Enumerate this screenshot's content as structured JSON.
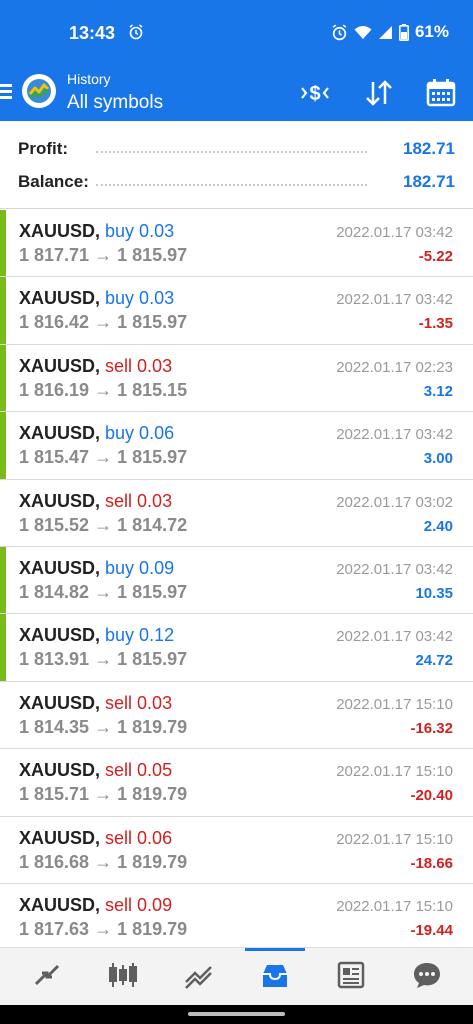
{
  "status_bar": {
    "time": "13:43",
    "battery": "61%"
  },
  "app_bar": {
    "title_small": "History",
    "title_big": "All symbols"
  },
  "summary": {
    "profit_label": "Profit:",
    "profit_value": "182.71",
    "balance_label": "Balance:",
    "balance_value": "182.71"
  },
  "deals": [
    {
      "symbol": "XAUUSD,",
      "side": "buy 0.03",
      "prices": "1 817.71 → 1 815.97",
      "date": "2022.01.17 03:42",
      "profit": "-5.22"
    },
    {
      "symbol": "XAUUSD,",
      "side": "buy 0.03",
      "prices": "1 816.42 → 1 815.97",
      "date": "2022.01.17 03:42",
      "profit": "-1.35"
    },
    {
      "symbol": "XAUUSD,",
      "side": "sell 0.03",
      "prices": "1 816.19 → 1 815.15",
      "date": "2022.01.17 02:23",
      "profit": "3.12"
    },
    {
      "symbol": "XAUUSD,",
      "side": "buy 0.06",
      "prices": "1 815.47 → 1 815.97",
      "date": "2022.01.17 03:42",
      "profit": "3.00"
    },
    {
      "symbol": "XAUUSD,",
      "side": "sell 0.03",
      "prices": "1 815.52 → 1 814.72",
      "date": "2022.01.17 03:02",
      "profit": "2.40"
    },
    {
      "symbol": "XAUUSD,",
      "side": "buy 0.09",
      "prices": "1 814.82 → 1 815.97",
      "date": "2022.01.17 03:42",
      "profit": "10.35"
    },
    {
      "symbol": "XAUUSD,",
      "side": "buy 0.12",
      "prices": "1 813.91 → 1 815.97",
      "date": "2022.01.17 03:42",
      "profit": "24.72"
    },
    {
      "symbol": "XAUUSD,",
      "side": "sell 0.03",
      "prices": "1 814.35 → 1 819.79",
      "date": "2022.01.17 15:10",
      "profit": "-16.32"
    },
    {
      "symbol": "XAUUSD,",
      "side": "sell 0.05",
      "prices": "1 815.71 → 1 819.79",
      "date": "2022.01.17 15:10",
      "profit": "-20.40"
    },
    {
      "symbol": "XAUUSD,",
      "side": "sell 0.06",
      "prices": "1 816.68 → 1 819.79",
      "date": "2022.01.17 15:10",
      "profit": "-18.66"
    },
    {
      "symbol": "XAUUSD,",
      "side": "sell 0.09",
      "prices": "1 817.63 → 1 819.79",
      "date": "2022.01.17 15:10",
      "profit": "-19.44"
    }
  ],
  "colors": {
    "accent": "#1976e8",
    "buy_bar": "#78bb1a",
    "loss": "#d42020",
    "gain": "#1976e8"
  },
  "icons": {
    "toolbar": [
      "currency-filter-icon",
      "sort-icon",
      "calendar-icon"
    ],
    "bottom_nav": [
      "quotes-icon",
      "chart-icon",
      "trade-icon",
      "history-icon",
      "news-icon",
      "messages-icon"
    ]
  },
  "bottom_nav_active": "history"
}
